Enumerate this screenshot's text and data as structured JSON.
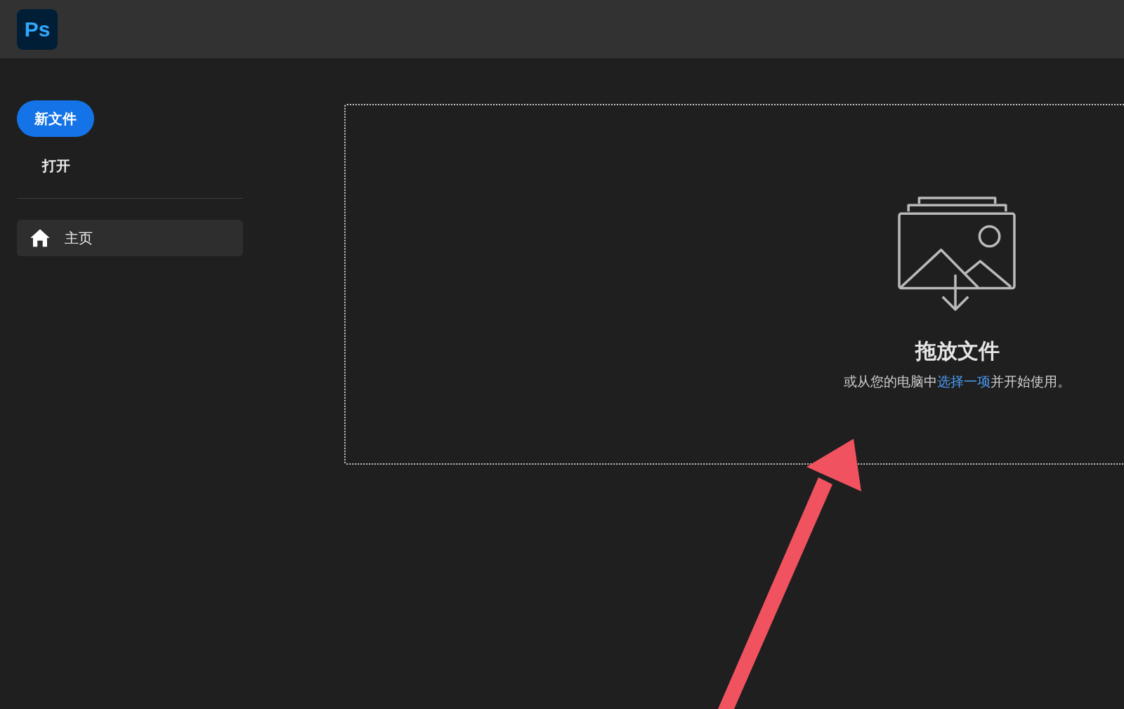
{
  "app_logo": {
    "text": "Ps"
  },
  "sidebar": {
    "primary_button": "新文件",
    "open_link": "打开",
    "nav_items": [
      {
        "label": "主页",
        "selected": true
      }
    ]
  },
  "drop_zone": {
    "title": "拖放文件",
    "hint_before": "或从您的电脑中",
    "hint_link": "选择一项",
    "hint_after": "并开始使用。"
  }
}
